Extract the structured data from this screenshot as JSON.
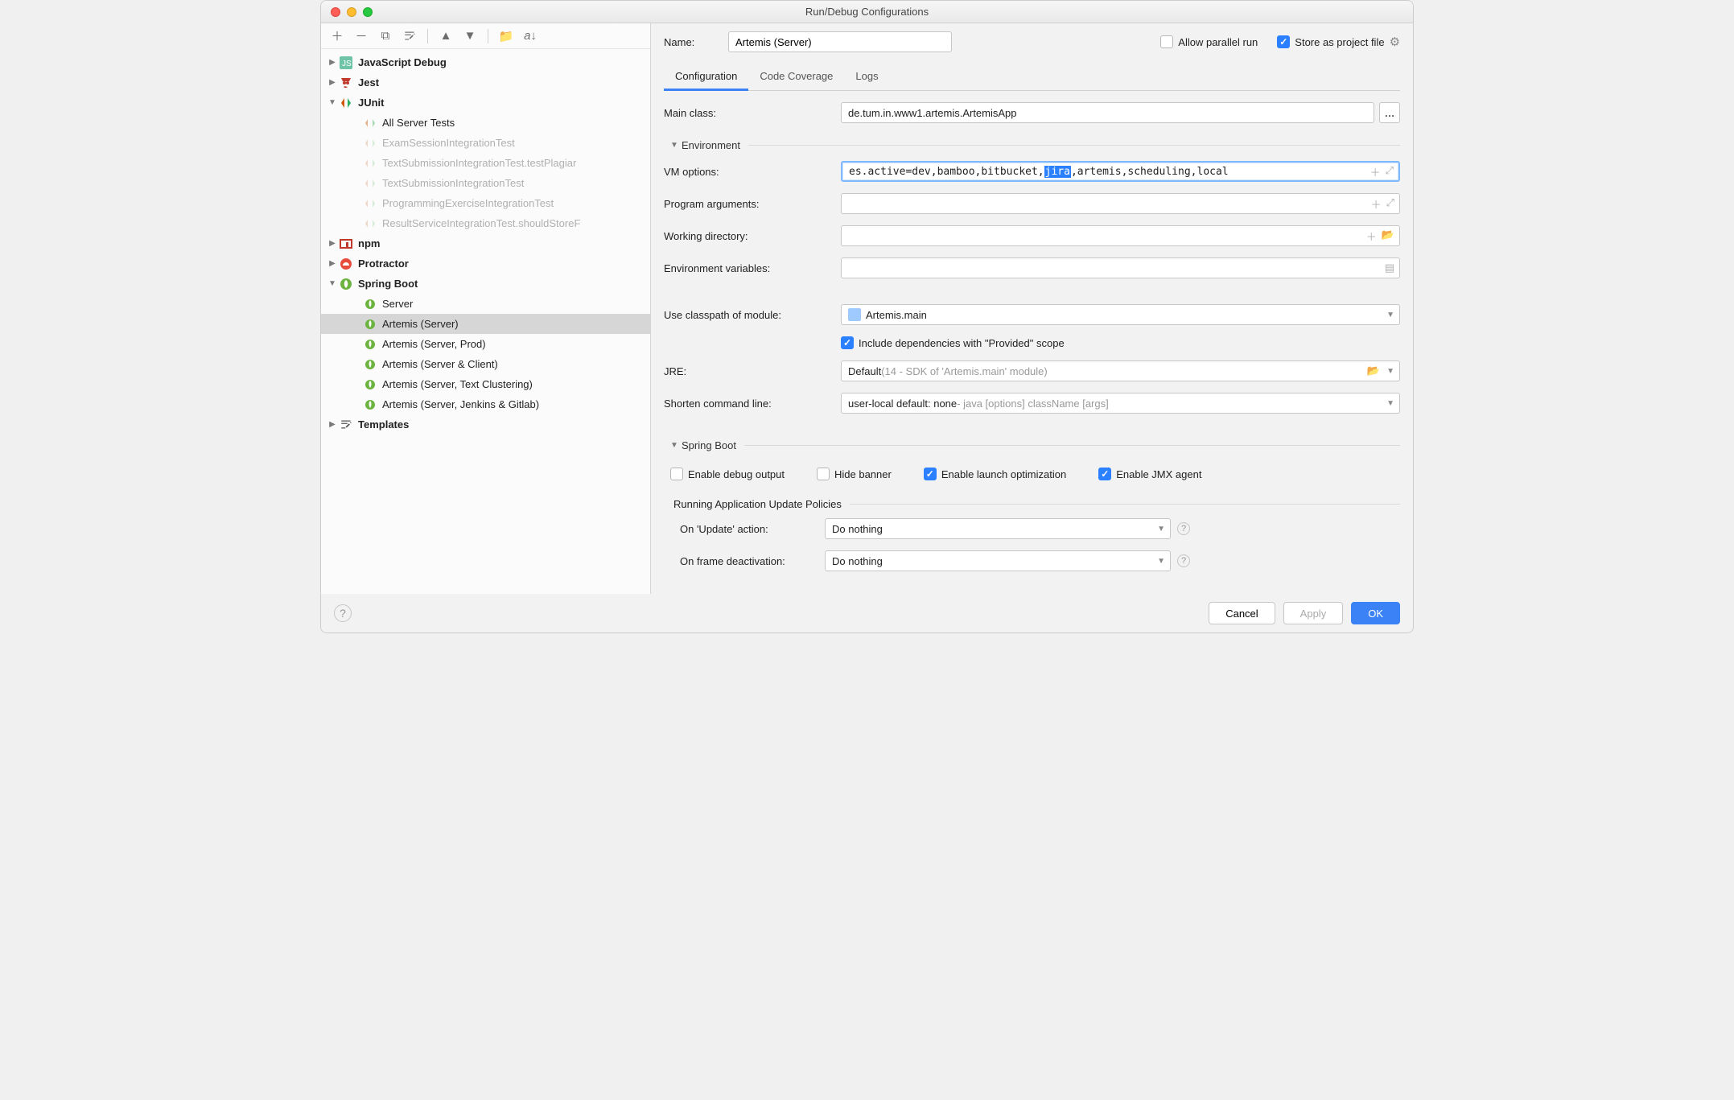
{
  "window": {
    "title": "Run/Debug Configurations"
  },
  "toolbar_icons": [
    "plus",
    "minus",
    "copy",
    "wrench",
    "up",
    "down",
    "folder-move",
    "sort"
  ],
  "tree": {
    "js_debug": "JavaScript Debug",
    "jest": "Jest",
    "junit": "JUnit",
    "junit_items": [
      "All Server Tests",
      "ExamSessionIntegrationTest",
      "TextSubmissionIntegrationTest.testPlagiar",
      "TextSubmissionIntegrationTest",
      "ProgrammingExerciseIntegrationTest",
      "ResultServiceIntegrationTest.shouldStoreF"
    ],
    "npm": "npm",
    "protractor": "Protractor",
    "spring_boot": "Spring Boot",
    "spring_items": [
      "Server",
      "Artemis (Server)",
      "Artemis (Server, Prod)",
      "Artemis (Server & Client)",
      "Artemis (Server, Text Clustering)",
      "Artemis (Server, Jenkins & Gitlab)"
    ],
    "templates": "Templates"
  },
  "header": {
    "name_label": "Name:",
    "name_value": "Artemis (Server)",
    "allow_parallel": "Allow parallel run",
    "store_project": "Store as project file"
  },
  "tabs": [
    "Configuration",
    "Code Coverage",
    "Logs"
  ],
  "form": {
    "main_class_label": "Main class:",
    "main_class_value": "de.tum.in.www1.artemis.ArtemisApp",
    "environment": "Environment",
    "vm_label": "VM options:",
    "vm_value_pre": "es.active=dev,bamboo,bitbucket,",
    "vm_value_hl": "jira",
    "vm_value_post": ",artemis,scheduling,local",
    "prog_args_label": "Program arguments:",
    "workdir_label": "Working directory:",
    "envvar_label": "Environment variables:",
    "classpath_label": "Use classpath of module:",
    "classpath_value": "Artemis.main",
    "include_provided": "Include dependencies with \"Provided\" scope",
    "jre_label": "JRE:",
    "jre_value": "Default",
    "jre_gray": " (14 - SDK of 'Artemis.main' module)",
    "shorten_label": "Shorten command line:",
    "shorten_value": "user-local default: none",
    "shorten_gray": " - java [options] className [args]",
    "spring_section": "Spring Boot",
    "enable_debug": "Enable debug output",
    "hide_banner": "Hide banner",
    "enable_launch": "Enable launch optimization",
    "enable_jmx": "Enable JMX agent",
    "update_policies": "Running Application Update Policies",
    "on_update_label": "On 'Update' action:",
    "on_update_value": "Do nothing",
    "on_deact_label": "On frame deactivation:",
    "on_deact_value": "Do nothing"
  },
  "footer": {
    "cancel": "Cancel",
    "apply": "Apply",
    "ok": "OK"
  }
}
